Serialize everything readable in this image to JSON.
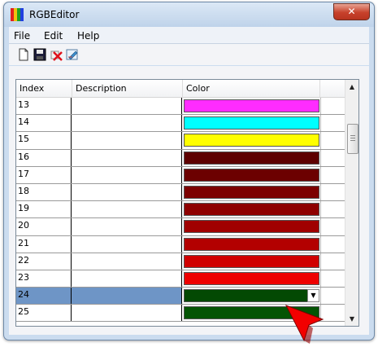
{
  "window": {
    "title": "RGBEditor",
    "close_glyph": "✕"
  },
  "app_icon_colors": [
    "#e02020",
    "#f0c010",
    "#20a020",
    "#2040e0"
  ],
  "menu": {
    "file": "File",
    "edit": "Edit",
    "help": "Help"
  },
  "toolbar": {
    "icons": [
      "new-document-icon",
      "save-disk-icon",
      "delete-icon",
      "edit-icon"
    ]
  },
  "grid": {
    "columns": {
      "index": "Index",
      "description": "Description",
      "color": "Color"
    },
    "selected_index": 11,
    "rows": [
      {
        "index": "13",
        "description": "",
        "color": "#ff2cff"
      },
      {
        "index": "14",
        "description": "",
        "color": "#00ffff"
      },
      {
        "index": "15",
        "description": "",
        "color": "#ffff00"
      },
      {
        "index": "16",
        "description": "",
        "color": "#5e0000"
      },
      {
        "index": "17",
        "description": "",
        "color": "#6c0000"
      },
      {
        "index": "18",
        "description": "",
        "color": "#7c0000"
      },
      {
        "index": "19",
        "description": "",
        "color": "#8e0000"
      },
      {
        "index": "20",
        "description": "",
        "color": "#a00000"
      },
      {
        "index": "21",
        "description": "",
        "color": "#b30000"
      },
      {
        "index": "22",
        "description": "",
        "color": "#d00000"
      },
      {
        "index": "23",
        "description": "",
        "color": "#ee0000"
      },
      {
        "index": "24",
        "description": "",
        "color": "#034903"
      },
      {
        "index": "25",
        "description": "",
        "color": "#045404"
      }
    ]
  }
}
